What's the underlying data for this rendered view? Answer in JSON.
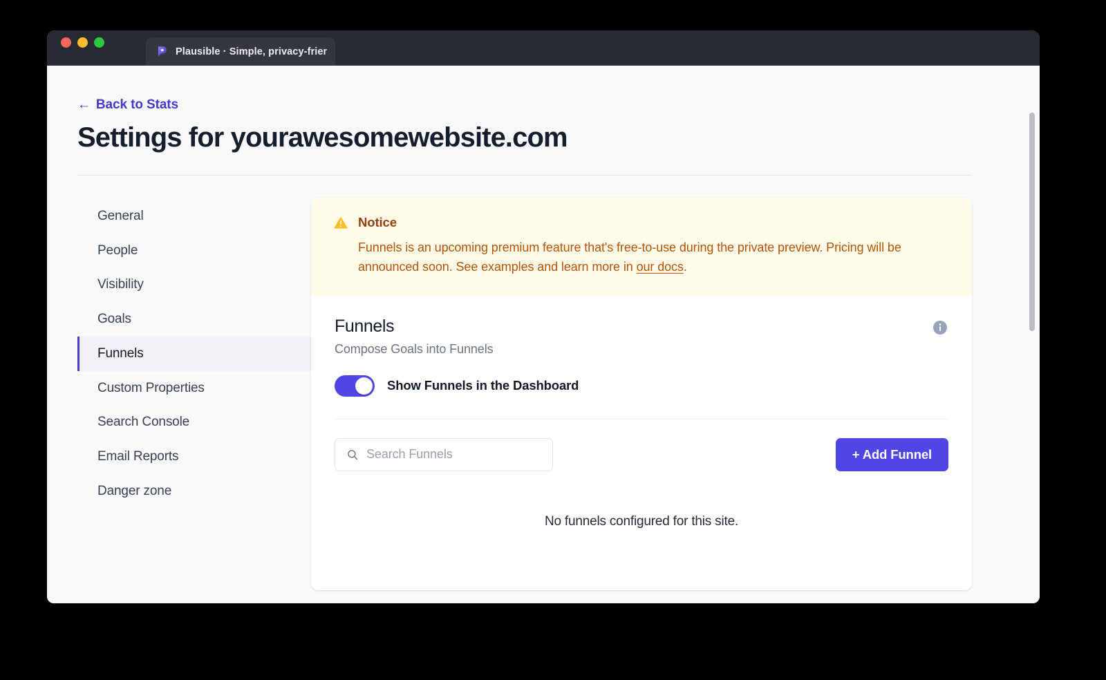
{
  "window": {
    "traffic_lights": [
      "close",
      "minimize",
      "zoom"
    ],
    "tab": {
      "favicon": "plausible-logo-icon",
      "title": "Plausible · Simple, privacy-frien"
    }
  },
  "header": {
    "back_link": {
      "arrow": "←",
      "label": "Back to Stats"
    },
    "page_title": "Settings for yourawesomewebsite.com"
  },
  "sidebar": {
    "items": [
      {
        "label": "General",
        "active": false
      },
      {
        "label": "People",
        "active": false
      },
      {
        "label": "Visibility",
        "active": false
      },
      {
        "label": "Goals",
        "active": false
      },
      {
        "label": "Funnels",
        "active": true
      },
      {
        "label": "Custom Properties",
        "active": false
      },
      {
        "label": "Search Console",
        "active": false
      },
      {
        "label": "Email Reports",
        "active": false
      },
      {
        "label": "Danger zone",
        "active": false
      }
    ]
  },
  "notice": {
    "icon": "warning-triangle-icon",
    "title": "Notice",
    "body_before_link": "Funnels is an upcoming premium feature that's free-to-use during the private preview. Pricing will be announced soon. See examples and learn more in ",
    "link_label": "our docs",
    "body_after_link": "."
  },
  "funnels": {
    "title": "Funnels",
    "subtitle": "Compose Goals into Funnels",
    "info_icon": "info-circle-icon",
    "toggle": {
      "label": "Show Funnels in the Dashboard",
      "state": "on"
    },
    "search": {
      "icon": "search-icon",
      "placeholder": "Search Funnels",
      "value": ""
    },
    "add_button_label": "+ Add Funnel",
    "empty_state": "No funnels configured for this site."
  },
  "colors": {
    "accent_indigo": "#4f46e5",
    "link_indigo": "#4338ca",
    "notice_bg": "#fefce8",
    "notice_title": "#92400e",
    "notice_text": "#b45309",
    "warning_amber": "#fbbf24",
    "info_gray": "#94a3b8",
    "page_bg": "#f7f9fb",
    "card_bg": "#ffffff",
    "titlebar_bg": "#272a30"
  }
}
